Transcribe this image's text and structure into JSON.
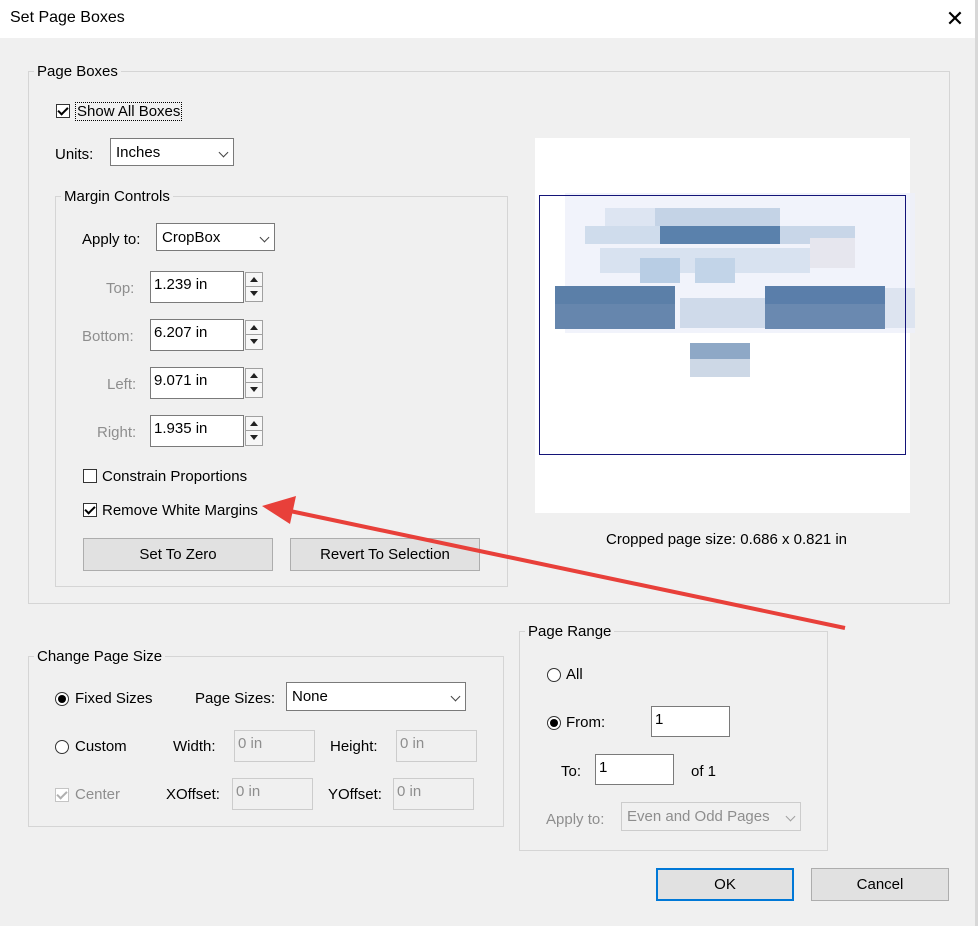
{
  "window": {
    "title": "Set Page Boxes",
    "close_label": "✕"
  },
  "page_boxes": {
    "legend": "Page Boxes",
    "show_all_boxes": {
      "label": "Show All Boxes",
      "checked": true
    },
    "units": {
      "label": "Units:",
      "value": "Inches"
    },
    "margin_controls": {
      "legend": "Margin Controls",
      "apply_to": {
        "label": "Apply to:",
        "value": "CropBox"
      },
      "top": {
        "label": "Top:",
        "value": "1.239 in"
      },
      "bottom": {
        "label": "Bottom:",
        "value": "6.207 in"
      },
      "left": {
        "label": "Left:",
        "value": "9.071 in"
      },
      "right": {
        "label": "Right:",
        "value": "1.935 in"
      },
      "constrain": {
        "label": "Constrain Proportions",
        "checked": false
      },
      "remove_white": {
        "label": "Remove White Margins",
        "checked": true
      },
      "set_to_zero": "Set To Zero",
      "revert": "Revert To Selection"
    },
    "cropped_size": "Cropped page size: 0.686 x 0.821 in"
  },
  "change_page_size": {
    "legend": "Change Page Size",
    "fixed_sizes": {
      "label": "Fixed Sizes",
      "selected": true
    },
    "page_sizes": {
      "label": "Page Sizes:",
      "value": "None"
    },
    "custom": {
      "label": "Custom",
      "selected": false
    },
    "width": {
      "label": "Width:",
      "value": "0 in"
    },
    "height": {
      "label": "Height:",
      "value": "0 in"
    },
    "center": {
      "label": "Center",
      "checked": true
    },
    "xoffset": {
      "label": "XOffset:",
      "value": "0 in"
    },
    "yoffset": {
      "label": "YOffset:",
      "value": "0 in"
    }
  },
  "page_range": {
    "legend": "Page Range",
    "all": {
      "label": "All",
      "selected": false
    },
    "from": {
      "label": "From:",
      "value": "1",
      "selected": true
    },
    "to": {
      "label": "To:",
      "value": "1"
    },
    "of": "of 1",
    "apply_to": {
      "label": "Apply to:",
      "value": "Even and Odd Pages"
    }
  },
  "buttons": {
    "ok": "OK",
    "cancel": "Cancel"
  },
  "colors": {
    "accent": "#0078d7",
    "arrow": "#e8403a",
    "crop_border": "#141478"
  }
}
